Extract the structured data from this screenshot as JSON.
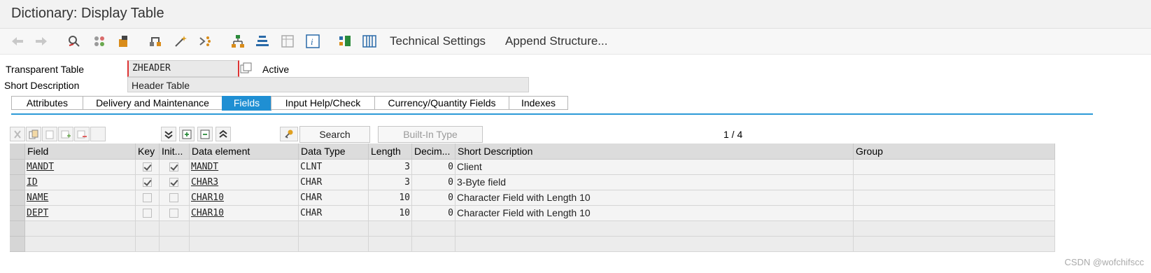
{
  "window": {
    "title": "Dictionary: Display Table"
  },
  "toolbar": {
    "technical_settings": "Technical Settings",
    "append_structure": "Append Structure..."
  },
  "header": {
    "transparent_table_label": "Transparent Table",
    "table_name": "ZHEADER",
    "status": "Active",
    "short_description_label": "Short Description",
    "short_description": "Header Table"
  },
  "tabs": [
    "Attributes",
    "Delivery and Maintenance",
    "Fields",
    "Input Help/Check",
    "Currency/Quantity Fields",
    "Indexes"
  ],
  "table_toolbar": {
    "search": "Search",
    "builtin_type": "Built-In Type",
    "page": "1 / 4"
  },
  "grid": {
    "columns": [
      "Field",
      "Key",
      "Init...",
      "Data element",
      "Data Type",
      "Length",
      "Decim...",
      "Short Description",
      "Group"
    ],
    "rows": [
      {
        "field": "MANDT",
        "key": true,
        "init": true,
        "data_element": "MANDT",
        "data_type": "CLNT",
        "length": "3",
        "decimals": "0",
        "description": "Client"
      },
      {
        "field": "ID",
        "key": true,
        "init": true,
        "data_element": "CHAR3",
        "data_type": "CHAR",
        "length": "3",
        "decimals": "0",
        "description": "3-Byte field"
      },
      {
        "field": "NAME",
        "key": false,
        "init": false,
        "data_element": "CHAR10",
        "data_type": "CHAR",
        "length": "10",
        "decimals": "0",
        "description": "Character Field with Length 10"
      },
      {
        "field": "DEPT",
        "key": false,
        "init": false,
        "data_element": "CHAR10",
        "data_type": "CHAR",
        "length": "10",
        "decimals": "0",
        "description": "Character Field with Length 10"
      }
    ]
  },
  "watermark": "CSDN @wofchifscc",
  "colors": {
    "accent": "#1f8fd3",
    "tab_line": "#2c9ad7"
  }
}
